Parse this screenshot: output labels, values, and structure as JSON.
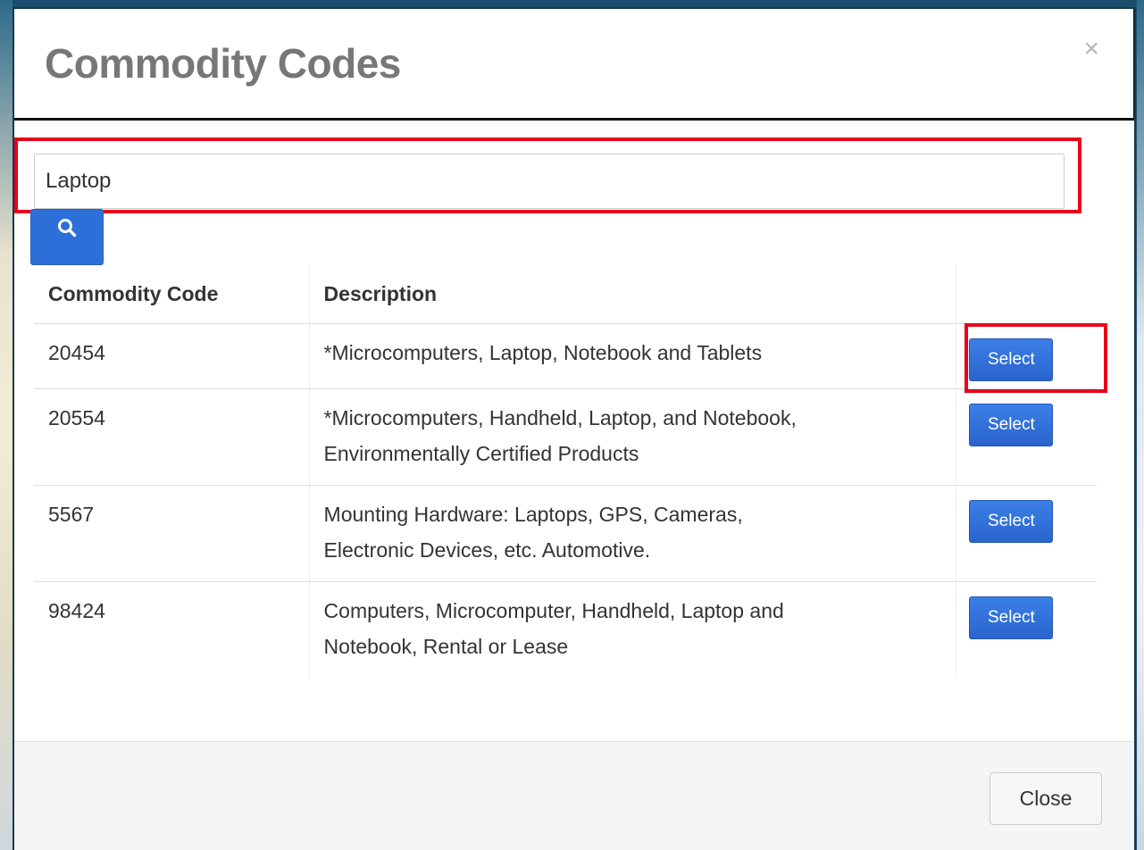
{
  "modal": {
    "title": "Commodity Codes",
    "close_icon": "close-icon",
    "close_glyph": "×"
  },
  "search": {
    "value": "Laptop",
    "button_icon": "search-icon"
  },
  "table": {
    "headers": {
      "code": "Commodity Code",
      "description": "Description",
      "action": ""
    },
    "rows": [
      {
        "code": "20454",
        "description_lines": [
          "*Microcomputers, Laptop, Notebook and Tablets"
        ],
        "action_label": "Select"
      },
      {
        "code": "20554",
        "description_lines": [
          "*Microcomputers, Handheld, Laptop, and Notebook,",
          "Environmentally Certified Products"
        ],
        "action_label": "Select"
      },
      {
        "code": "5567",
        "description_lines": [
          "Mounting Hardware: Laptops, GPS, Cameras,",
          "Electronic Devices, etc. Automotive."
        ],
        "action_label": "Select"
      },
      {
        "code": "98424",
        "description_lines": [
          "Computers, Microcomputer, Handheld, Laptop and",
          "Notebook, Rental or Lease"
        ],
        "action_label": "Select"
      }
    ]
  },
  "footer": {
    "close_label": "Close"
  },
  "colors": {
    "accent_blue": "#2d6fd8",
    "highlight_red": "#e8001c",
    "title_gray": "#777777"
  }
}
